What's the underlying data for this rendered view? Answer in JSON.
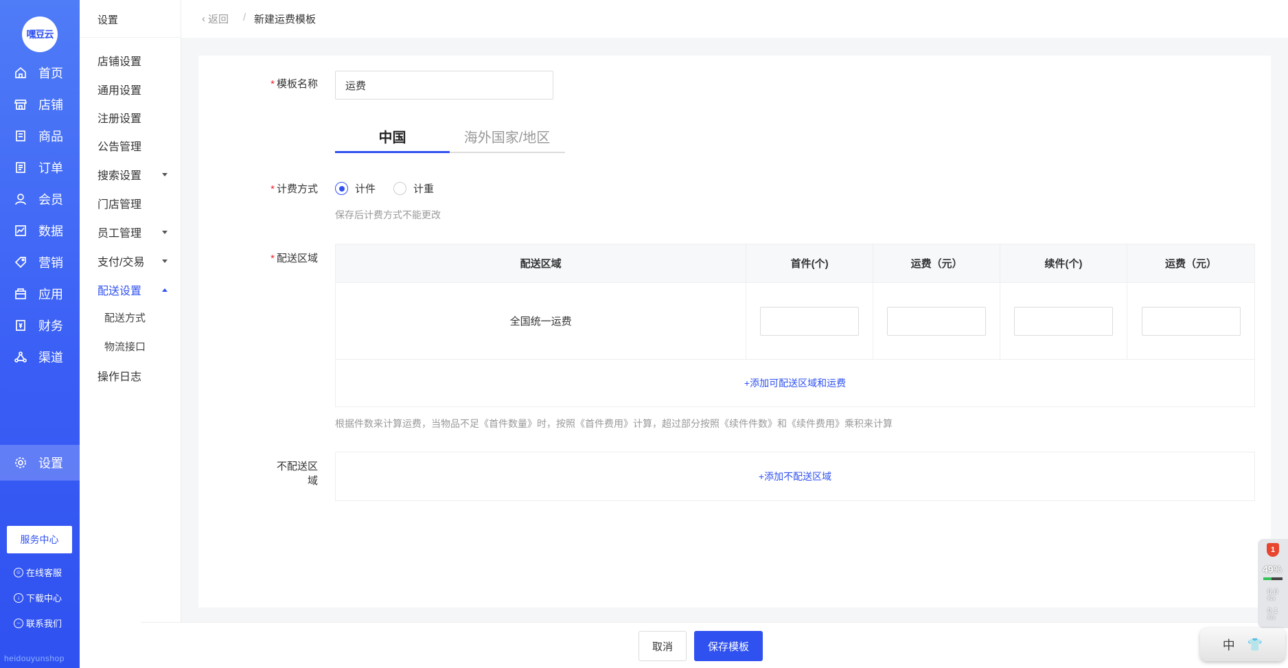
{
  "brand": {
    "logo_text": "嘿豆云",
    "footer_text": "heidouyunshop"
  },
  "nav_primary": [
    {
      "label": "首页",
      "icon": "home-icon"
    },
    {
      "label": "店铺",
      "icon": "store-icon"
    },
    {
      "label": "商品",
      "icon": "goods-icon"
    },
    {
      "label": "订单",
      "icon": "order-icon"
    },
    {
      "label": "会员",
      "icon": "user-icon"
    },
    {
      "label": "数据",
      "icon": "chart-icon"
    },
    {
      "label": "营销",
      "icon": "tag-icon"
    },
    {
      "label": "应用",
      "icon": "app-icon"
    },
    {
      "label": "财务",
      "icon": "finance-icon"
    },
    {
      "label": "渠道",
      "icon": "channel-icon"
    },
    {
      "label": "设置",
      "icon": "gear-icon"
    }
  ],
  "service": {
    "center": "服务中心",
    "online": "在线客服",
    "download": "下载中心",
    "contact": "联系我们"
  },
  "nav_secondary": {
    "title": "设置",
    "items": [
      "店铺设置",
      "通用设置",
      "注册设置",
      "公告管理",
      "搜索设置",
      "门店管理",
      "员工管理",
      "支付/交易",
      "配送设置"
    ],
    "sub_items": [
      "配送方式",
      "物流接口"
    ],
    "last_item": "操作日志"
  },
  "breadcrumb": {
    "back": "返回",
    "sep": "/",
    "current": "新建运费模板"
  },
  "form": {
    "name_label": "模板名称",
    "name_value": "运费",
    "tabs": [
      "中国",
      "海外国家/地区"
    ],
    "billing_label": "计费方式",
    "billing_options": [
      "计件",
      "计重"
    ],
    "billing_hint": "保存后计费方式不能更改",
    "area_label": "配送区域",
    "table_headers": [
      "配送区域",
      "首件(个)",
      "运费（元）",
      "续件(个)",
      "运费（元）"
    ],
    "table_row_area": "全国统一运费",
    "add_area": "+添加可配送区域和运费",
    "rule_hint": "根据件数来计算运费，当物品不足《首件数量》时，按照《首件费用》计算，超过部分按照《续件件数》和《续件费用》乘积来计算",
    "no_delivery_label": "不配送区域",
    "add_no_delivery": "+添加不配送区域"
  },
  "footer": {
    "cancel": "取消",
    "save": "保存模板"
  },
  "widget": {
    "badge": "1",
    "percent": "49%",
    "up": "0.0",
    "down": "0.1",
    "unit": "K/s"
  },
  "ime": {
    "lang": "中",
    "skin_icon": "shirt-icon"
  },
  "colors": {
    "primary": "#2f51f0",
    "required": "#f5222d"
  }
}
